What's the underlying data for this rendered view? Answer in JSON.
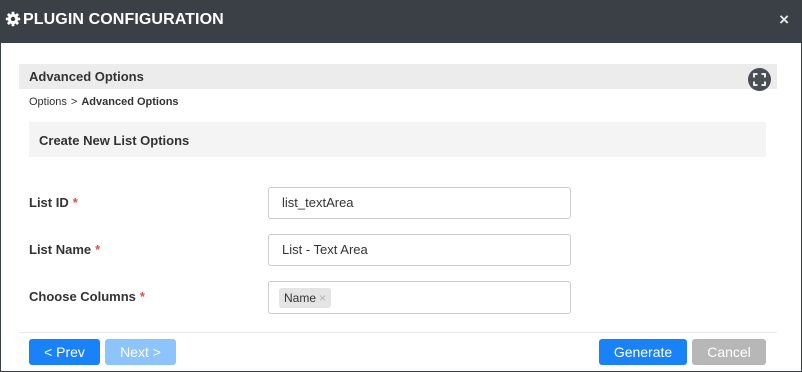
{
  "dialog": {
    "title": "PLUGIN CONFIGURATION",
    "close_label": "×",
    "icons": {
      "title_icon": "gear-icon",
      "close_icon": "close-icon",
      "expand_icon": "fullscreen-icon"
    }
  },
  "section": {
    "title": "Advanced Options"
  },
  "breadcrumb": {
    "items": [
      "Options",
      "Advanced Options"
    ],
    "separator": ">"
  },
  "subsection": {
    "title": "Create New List Options"
  },
  "form": {
    "list_id": {
      "label": "List ID",
      "required_mark": "*",
      "value": "list_textArea"
    },
    "list_name": {
      "label": "List Name",
      "required_mark": "*",
      "value": "List - Text Area"
    },
    "columns": {
      "label": "Choose Columns",
      "required_mark": "*",
      "tags": [
        "Name"
      ],
      "tag_remove": "×"
    }
  },
  "buttons": {
    "prev": "< Prev",
    "next": "Next >",
    "generate": "Generate",
    "cancel": "Cancel"
  },
  "colors": {
    "titlebar": "#3b4047",
    "primary": "#1a82f7",
    "primary_disabled": "#8cc4fb",
    "cancel": "#b7b7b7",
    "required": "#d9534f"
  }
}
